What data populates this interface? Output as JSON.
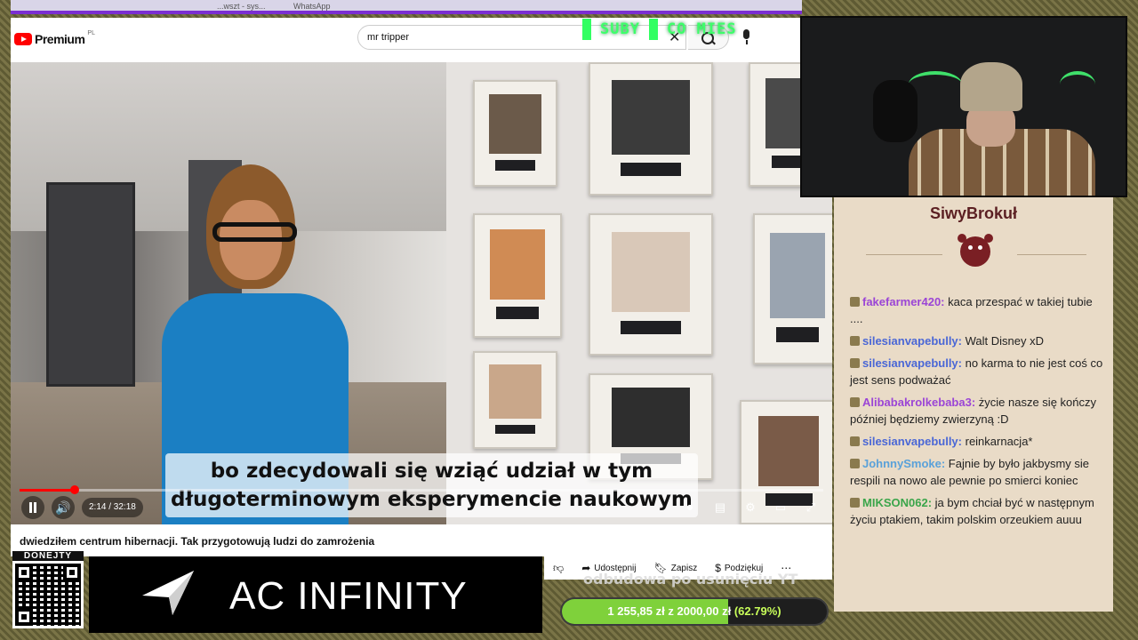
{
  "browser": {
    "tabs": [
      "...wszt - sys...",
      "WhatsApp"
    ]
  },
  "youtube": {
    "brand": "Premium",
    "region": "PL",
    "search_value": "mr tripper"
  },
  "overlay": {
    "subs_label": "SUBY",
    "month_label": "CO MIES"
  },
  "player": {
    "caption_line1": "bo zdecydowali się wziąć udział w tym",
    "caption_line2": "długoterminowym eksperymencie naukowym",
    "time_current": "2:14",
    "time_total": "32:18",
    "time_display": "2:14 / 32:18",
    "progress": 0.069
  },
  "video": {
    "title": "dwiedziłem centrum hibernacji. Tak przygotowują ludzi do zamrożenia"
  },
  "actions": {
    "share": "Udostępnij",
    "save": "Zapisz",
    "thanks": "Podziękuj"
  },
  "donate": {
    "label": "DONEJTY"
  },
  "ad": {
    "brand": "AC INFINITY"
  },
  "goal": {
    "title": "odbudowa po usunięciu YT",
    "current": "1 255,85 zł",
    "sep": "z",
    "target": "2000,00 zł",
    "percent_text": "(62.79%)",
    "fraction": 0.6279,
    "color": "#7fd13b"
  },
  "chat": {
    "channel": "SiwyBrokuł",
    "messages": [
      {
        "user": "fakefarmer420:",
        "color": "#9b45d6",
        "text": "kaca przespać w takiej tubie ...."
      },
      {
        "user": "silesianvapebully:",
        "color": "#4a67d6",
        "text": "Walt Disney xD"
      },
      {
        "user": "silesianvapebully:",
        "color": "#4a67d6",
        "text": "no karma to nie jest coś co jest sens podważać"
      },
      {
        "user": "Alibabakrolkebaba3:",
        "color": "#9b45d6",
        "text": "życie nasze się kończy później będziemy zwierzyną :D"
      },
      {
        "user": "silesianvapebully:",
        "color": "#4a67d6",
        "text": "reinkarnacja*"
      },
      {
        "user": "JohnnySmoke:",
        "color": "#5aa1d9",
        "text": "Fajnie by było jakbysmy sie respili na nowo ale pewnie po smierci koniec"
      },
      {
        "user": "MIKSON062:",
        "color": "#3aa54a",
        "text": "ja bym chciał być w następnym życiu ptakiem, takim polskim orzeukiem auuu"
      }
    ]
  }
}
